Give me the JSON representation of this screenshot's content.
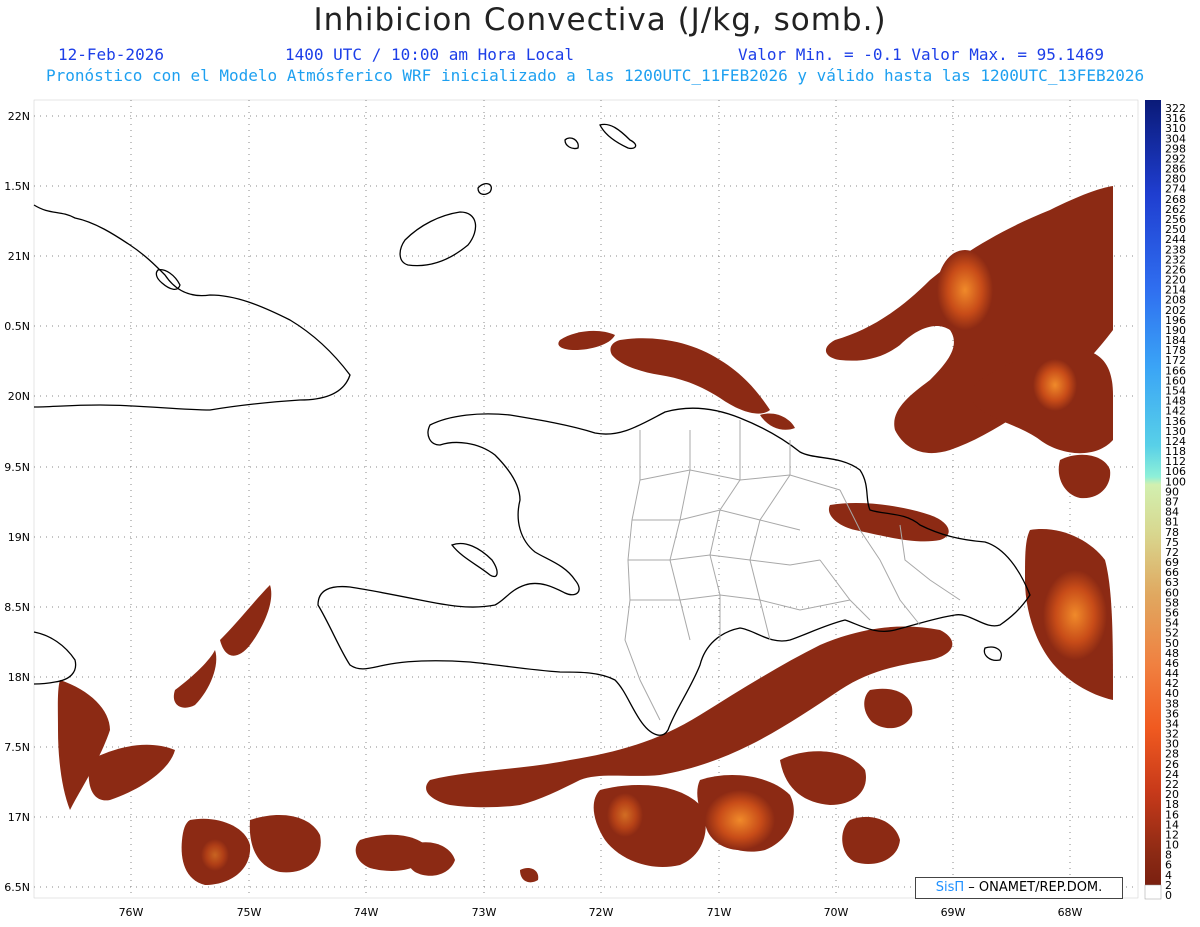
{
  "title": "Inhibicion Convectiva (J/kg, somb.)",
  "header": {
    "date": "12-Feb-2026",
    "time": "1400 UTC / 10:00 am Hora Local",
    "min_max": "Valor Min. = -0.1  Valor Max. = 95.1469",
    "model_info": "Pronóstico con el Modelo Atmósferico WRF inicializado a las 1200UTC_11FEB2026 y válido hasta las  1200UTC_13FEB2026"
  },
  "credit": {
    "brand": "SisΠ",
    "org": "– ONAMET/REP.DOM."
  },
  "lat_labels": [
    "22N",
    "1.5N",
    "21N",
    "0.5N",
    "20N",
    "9.5N",
    "19N",
    "8.5N",
    "18N",
    "7.5N",
    "17N",
    "6.5N"
  ],
  "lon_labels": [
    "76W",
    "75W",
    "74W",
    "73W",
    "72W",
    "71W",
    "70W",
    "69W",
    "68W"
  ],
  "colorbar_labels": [
    "322",
    "316",
    "310",
    "304",
    "298",
    "292",
    "286",
    "280",
    "274",
    "268",
    "262",
    "256",
    "250",
    "244",
    "238",
    "232",
    "226",
    "220",
    "214",
    "208",
    "202",
    "196",
    "190",
    "184",
    "178",
    "172",
    "166",
    "160",
    "154",
    "148",
    "142",
    "136",
    "130",
    "124",
    "118",
    "112",
    "106",
    "100",
    "90",
    "87",
    "84",
    "81",
    "78",
    "75",
    "72",
    "69",
    "66",
    "63",
    "60",
    "58",
    "56",
    "54",
    "52",
    "50",
    "48",
    "46",
    "44",
    "42",
    "40",
    "38",
    "36",
    "34",
    "32",
    "30",
    "28",
    "26",
    "24",
    "22",
    "20",
    "18",
    "16",
    "14",
    "12",
    "10",
    "8",
    "6",
    "4",
    "2",
    "0"
  ],
  "colors": {
    "cin_field": "#8c2a14",
    "cin_high": "#d6561a",
    "coast": "#000000",
    "provinces": "#a8a8a8",
    "grid": "#888888"
  }
}
